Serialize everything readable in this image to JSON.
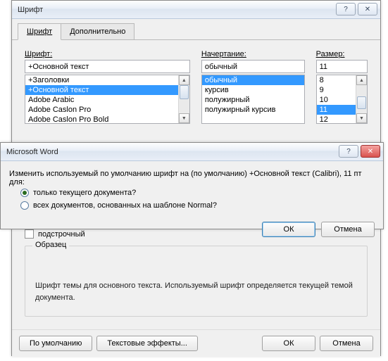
{
  "fontDialog": {
    "title": "Шрифт",
    "help_glyph": "?",
    "close_glyph": "✕",
    "tabs": {
      "font": "Шрифт",
      "advanced": "Дополнительно"
    },
    "labels": {
      "font": "Шрифт:",
      "style": "Начертание:",
      "size": "Размер:"
    },
    "values": {
      "font": "+Основной текст",
      "style": "обычный",
      "size": "11"
    },
    "fontList": [
      "+Заголовки",
      "+Основной текст",
      "Adobe Arabic",
      "Adobe Caslon Pro",
      "Adobe Caslon Pro Bold"
    ],
    "fontSelectedIndex": 1,
    "styleList": [
      "обычный",
      "курсив",
      "полужирный",
      "полужирный курсив"
    ],
    "styleSelectedIndex": 0,
    "sizeList": [
      "8",
      "9",
      "10",
      "11",
      "12"
    ],
    "sizeSelectedIndex": 3,
    "subscript": "подстрочный",
    "sample_label": "Образец",
    "sample_text": "Шрифт темы для основного текста. Используемый шрифт определяется текущей темой документа.",
    "buttons": {
      "default": "По умолчанию",
      "text_effects": "Текстовые эффекты...",
      "ok": "ОК",
      "cancel": "Отмена"
    }
  },
  "msgDialog": {
    "title": "Microsoft Word",
    "help_glyph": "?",
    "close_glyph": "✕",
    "prompt": "Изменить используемый по умолчанию шрифт на (по умолчанию) +Основной текст (Calibri), 11 пт для:",
    "options": {
      "current": "только текущего документа?",
      "all": "всех документов, основанных на шаблоне Normal?"
    },
    "selectedOption": "current",
    "buttons": {
      "ok": "ОК",
      "cancel": "Отмена"
    }
  }
}
